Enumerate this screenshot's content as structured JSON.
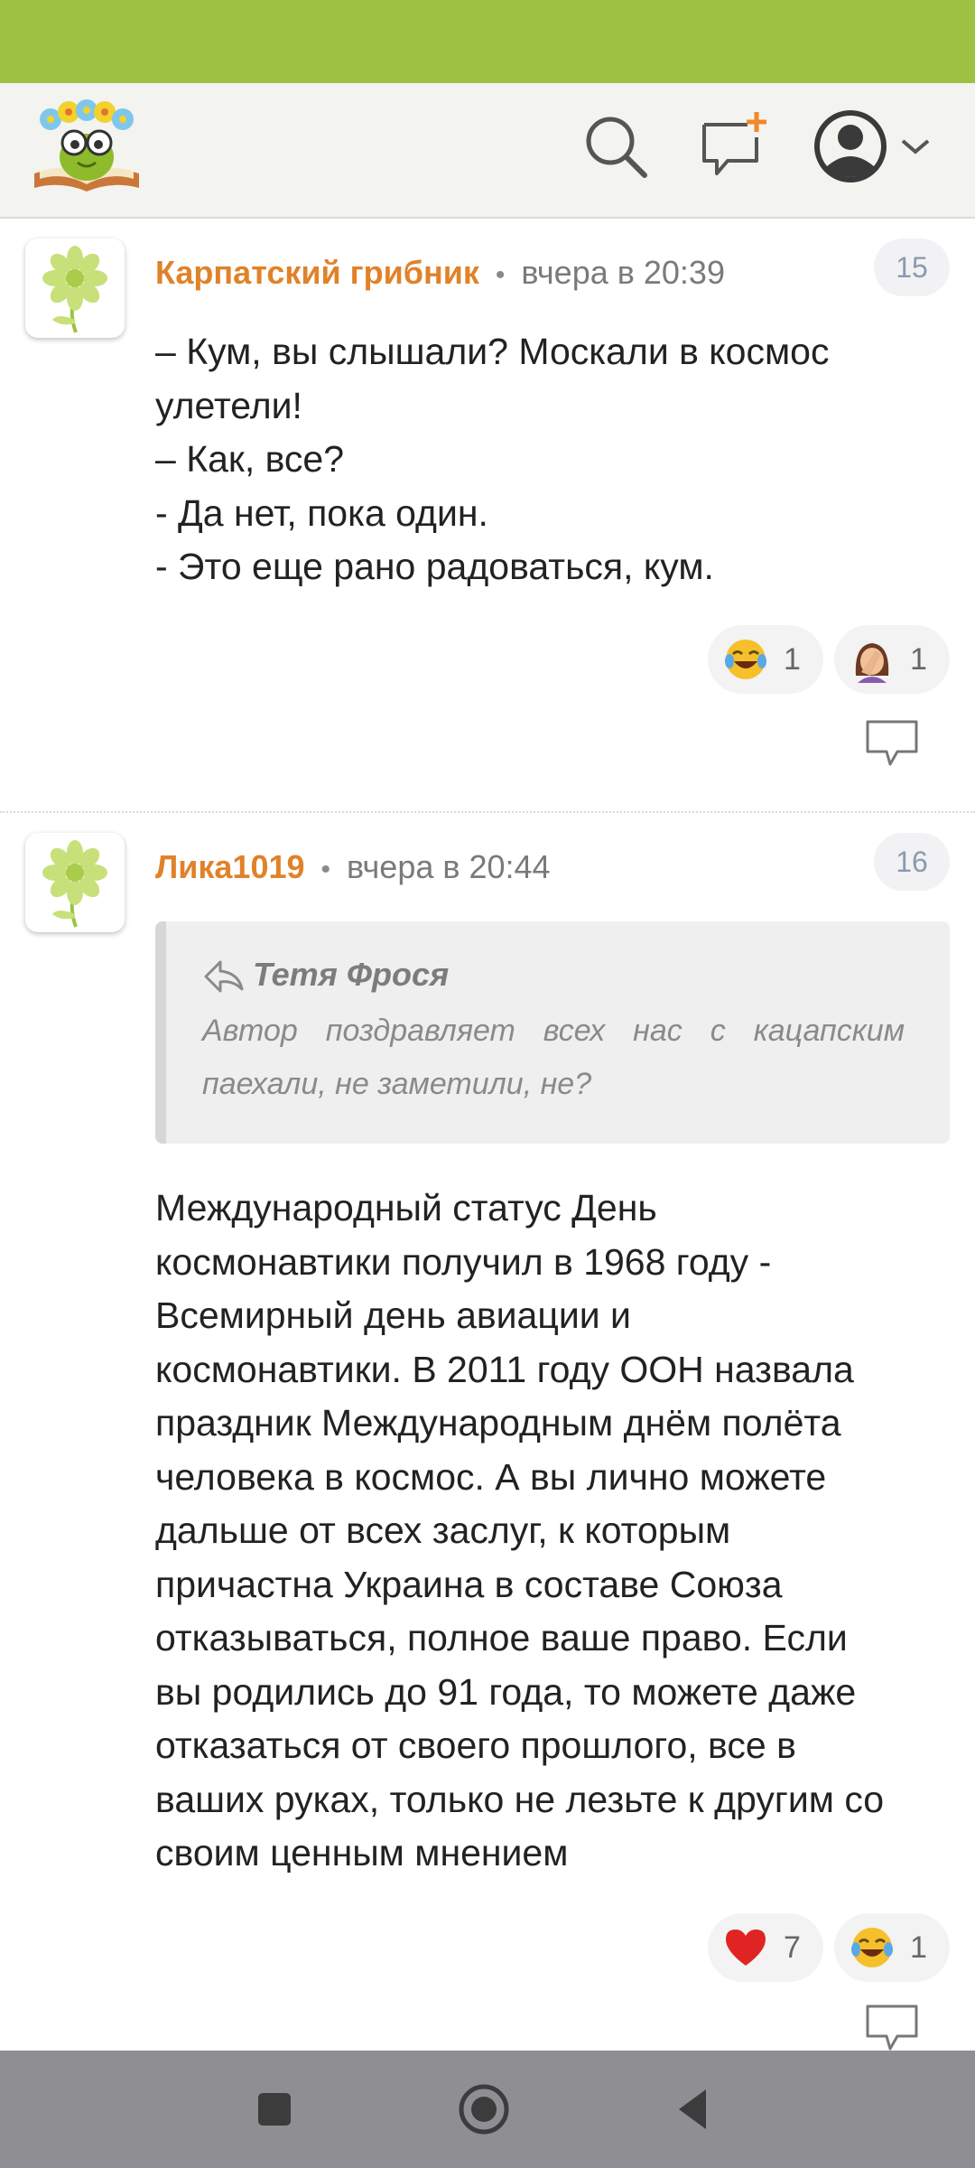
{
  "colors": {
    "status_bar": "#9dc243",
    "author_name": "#e0822a",
    "nav_bar": "#8e8e93"
  },
  "header": {
    "logo": "book-flower-logo",
    "icons": [
      "search-icon",
      "new-message-icon",
      "user-account-icon",
      "chevron-down-icon"
    ]
  },
  "comments": [
    {
      "author": "Карпатский грибник",
      "separator": "•",
      "time": "вчера в 20:39",
      "number": "15",
      "lines": [
        "– Кум, вы слышали? Москали в космос",
        "улетели!",
        "– Как, все?",
        "- Да нет, пока один.",
        "- Это еще рано радоваться, кум."
      ],
      "reactions": [
        {
          "emoji": "tears-of-joy",
          "count": "1"
        },
        {
          "emoji": "facepalm",
          "count": "1"
        }
      ]
    },
    {
      "author": "Лика1019",
      "separator": "•",
      "time": "вчера в 20:44",
      "number": "16",
      "quote": {
        "author": "Тетя Фрося",
        "lines": [
          "Автор поздравляет всех нас с кацапским",
          "паехали, не заметили, не?"
        ]
      },
      "lines": [
        "Международный статус День",
        "космонавтики получил в 1968 году -",
        "Всемирный день авиации и",
        "космонавтики. В 2011 году ООН назвала",
        "праздник Международным днём полёта",
        "человека в космос. А вы лично можете",
        "дальше от всех заслуг, к которым",
        "причастна Украина в составе Союза",
        "отказываться, полное ваше право. Если",
        "вы родились до 91 года, то можете даже",
        "отказаться от своего прошлого, все в",
        "ваших руках, только не лезьте к другим со",
        "своим ценным мнением"
      ],
      "reactions": [
        {
          "emoji": "red-heart",
          "count": "7"
        },
        {
          "emoji": "tears-of-joy",
          "count": "1"
        }
      ]
    }
  ],
  "nav": {
    "buttons": [
      "recents-button",
      "home-button",
      "back-button"
    ]
  }
}
